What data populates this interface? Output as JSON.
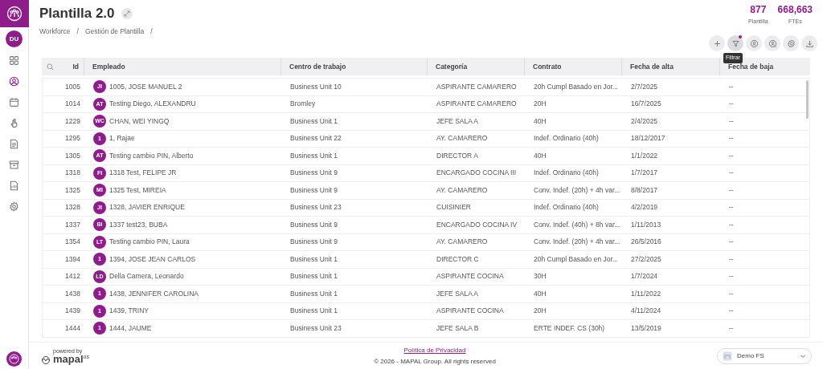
{
  "sidebar": {
    "avatar": "DU",
    "items": [
      {
        "kind": "grid",
        "selected": false
      },
      {
        "kind": "person",
        "selected": true
      },
      {
        "kind": "calendar",
        "selected": false
      },
      {
        "kind": "hand",
        "selected": false
      },
      {
        "kind": "document",
        "selected": false
      },
      {
        "kind": "archive",
        "selected": false
      },
      {
        "kind": "report",
        "selected": false
      },
      {
        "kind": "settings",
        "selected": false
      }
    ]
  },
  "header": {
    "title": "Plantilla 2.0",
    "breadcrumb": [
      "Workforce",
      "Gestión de Plantilla"
    ],
    "separator": "/"
  },
  "stats": [
    {
      "value": "877",
      "label": "Plantilla"
    },
    {
      "value": "668,663",
      "label": "FTEs"
    }
  ],
  "toolbar": [
    {
      "kind": "add",
      "indicator": false
    },
    {
      "kind": "filter",
      "indicator": true,
      "tooltip": "Filtrar"
    },
    {
      "kind": "user",
      "indicator": false
    },
    {
      "kind": "user-search",
      "indicator": false
    },
    {
      "kind": "settings",
      "indicator": false
    },
    {
      "kind": "download",
      "indicator": false
    }
  ],
  "table": {
    "columns": [
      "Id",
      "Empleado",
      "Centro de trabajo",
      "Categoría",
      "Contrato",
      "Fecha de alta",
      "Fecha de baja"
    ],
    "rows": [
      {
        "id": "1005",
        "initials": "JI",
        "name": "1005, JOSE MANUEL 2",
        "centro": "Business Unit 10",
        "categoria": "ASPIRANTE CAMARERO",
        "contrato": "20h Cumpl Basado en Jor...",
        "alta": "2/7/2025",
        "baja": "--"
      },
      {
        "id": "1014",
        "initials": "AT",
        "name": "Testing Diego, ALEXANDRU",
        "centro": "Bromley",
        "categoria": "ASPIRANTE CAMARERO",
        "contrato": "20H",
        "alta": "16/7/2025",
        "baja": "--"
      },
      {
        "id": "1229",
        "initials": "WC",
        "name": "CHAN, WEI YINGQ",
        "centro": "Business Unit 1",
        "categoria": "JEFE SALA A",
        "contrato": "40H",
        "alta": "2/4/2025",
        "baja": "--"
      },
      {
        "id": "1295",
        "initials": "1",
        "name": "1, Rajae",
        "centro": "Business Unit 22",
        "categoria": "AY. CAMARERO",
        "contrato": "Indef. Ordinario (40h)",
        "alta": "18/12/2017",
        "baja": "--"
      },
      {
        "id": "1305",
        "initials": "AT",
        "name": "Testing cambio PIN, Alberto",
        "centro": "Business Unit 1",
        "categoria": "DIRECTOR A",
        "contrato": "40H",
        "alta": "1/1/2022",
        "baja": "--"
      },
      {
        "id": "1318",
        "initials": "FI",
        "name": "1318 Test, FELIPE JR",
        "centro": "Business Unit 9",
        "categoria": "ENCARGADO COCINA III",
        "contrato": "Indef. Ordinario (40h)",
        "alta": "1/7/2017",
        "baja": "--"
      },
      {
        "id": "1325",
        "initials": "MI",
        "name": "1325 Test, MIREIA",
        "centro": "Business Unit 9",
        "categoria": "AY. CAMARERO",
        "contrato": "Conv. Indef. (20h) + 4h var...",
        "alta": "8/8/2017",
        "baja": "--"
      },
      {
        "id": "1328",
        "initials": "JI",
        "name": "1328, JAVIER ENRIQUE",
        "centro": "Business Unit 23",
        "categoria": "CUISINIER",
        "contrato": "Indef. Ordinario (40h)",
        "alta": "4/2/2019",
        "baja": "--"
      },
      {
        "id": "1337",
        "initials": "BI",
        "name": "1337 test23, BUBA",
        "centro": "Business Unit 9",
        "categoria": "ENCARGADO COCINA IV",
        "contrato": "Conv. Indef. (40h) + 8h var...",
        "alta": "1/11/2013",
        "baja": "--"
      },
      {
        "id": "1354",
        "initials": "LT",
        "name": "Testing cambio PIN, Laura",
        "centro": "Business Unit 9",
        "categoria": "AY. CAMARERO",
        "contrato": "Conv. Indef. (20h) + 4h var...",
        "alta": "26/5/2016",
        "baja": "--"
      },
      {
        "id": "1394",
        "initials": "1",
        "name": "1394, JOSE JEAN CARLOS",
        "centro": "Business Unit 1",
        "categoria": "DIRECTOR C",
        "contrato": "20h Cumpl Basado en Jor...",
        "alta": "27/2/2025",
        "baja": "--"
      },
      {
        "id": "1412",
        "initials": "LD",
        "name": "Della Camera, Leonardo",
        "centro": "Business Unit 1",
        "categoria": "ASPIRANTE COCINA",
        "contrato": "30H",
        "alta": "1/7/2024",
        "baja": "--"
      },
      {
        "id": "1438",
        "initials": "1",
        "name": "1438, JENNIFER CAROLINA",
        "centro": "Business Unit 1",
        "categoria": "JEFE SALA A",
        "contrato": "40H",
        "alta": "1/11/2022",
        "baja": "--"
      },
      {
        "id": "1439",
        "initials": "1",
        "name": "1439, TRINY",
        "centro": "Business Unit 1",
        "categoria": "ASPIRANTE COCINA",
        "contrato": "20H",
        "alta": "4/11/2024",
        "baja": "--"
      },
      {
        "id": "1444",
        "initials": "1",
        "name": "1444, JAUME",
        "centro": "Business Unit 23",
        "categoria": "JEFE SALA B",
        "contrato": "ERTE INDEF. CS (30h)",
        "alta": "13/5/2019",
        "baja": "--"
      }
    ]
  },
  "footer": {
    "brand_tagline": "powered by",
    "brand": "mapal",
    "brand_suffix": "os",
    "privacy_link": "Política de Privacidad",
    "copyright": "© 2026 - MAPAL Group. All rights reserved",
    "account": "Demo FS"
  }
}
